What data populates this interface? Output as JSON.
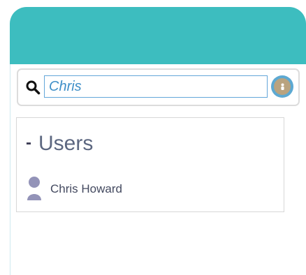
{
  "header": {
    "color": "#3dbdbf"
  },
  "search": {
    "value": "Chris",
    "input_border_color": "#63a6d9",
    "icon": "search-icon",
    "avatar_icon": "user-avatar-icon"
  },
  "results": {
    "section_toggle": "-",
    "section_title": "Users",
    "items": [
      {
        "name": "Chris Howard",
        "icon": "user-silhouette-icon",
        "icon_color": "#9393b8"
      }
    ]
  }
}
